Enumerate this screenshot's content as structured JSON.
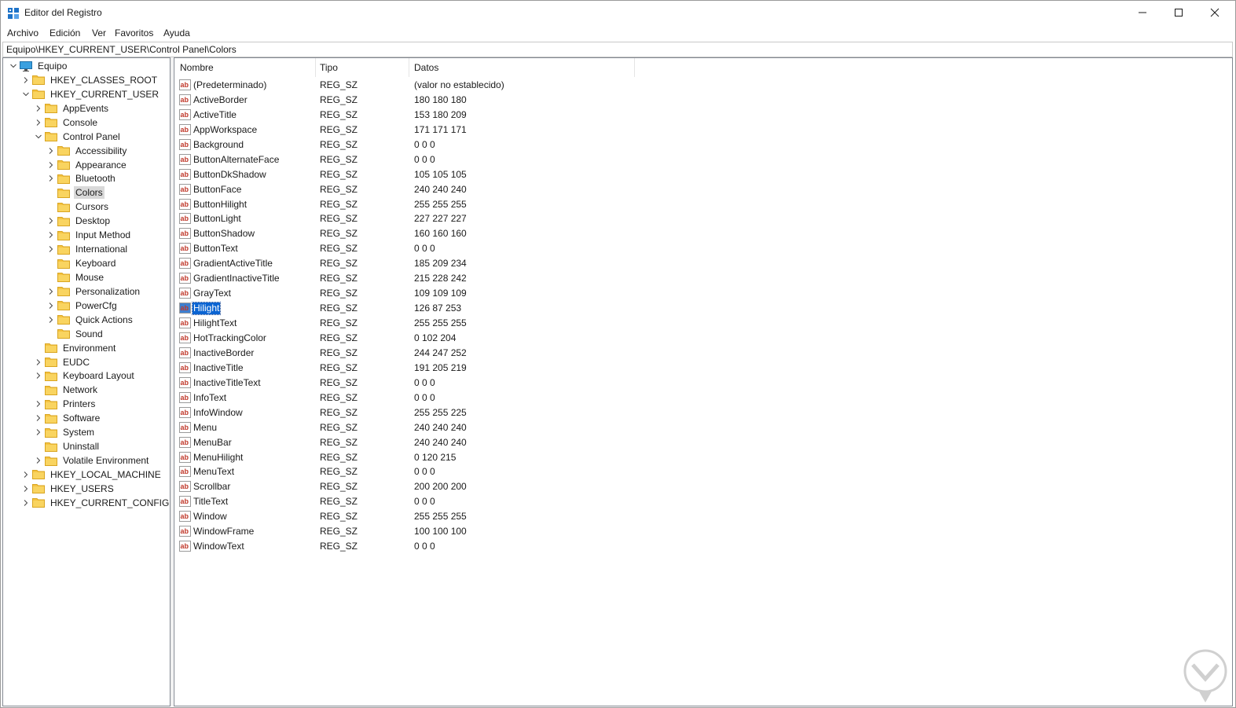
{
  "window": {
    "title": "Editor del Registro"
  },
  "menu": [
    "Archivo",
    "Edición",
    "Ver",
    "Favoritos",
    "Ayuda"
  ],
  "address": "Equipo\\HKEY_CURRENT_USER\\Control Panel\\Colors",
  "tree": [
    {
      "label": "Equipo",
      "level": 0,
      "expander": "expanded",
      "icon": "computer-icon"
    },
    {
      "label": "HKEY_CLASSES_ROOT",
      "level": 1,
      "expander": "collapsed"
    },
    {
      "label": "HKEY_CURRENT_USER",
      "level": 1,
      "expander": "expanded"
    },
    {
      "label": "AppEvents",
      "level": 2,
      "expander": "collapsed"
    },
    {
      "label": "Console",
      "level": 2,
      "expander": "collapsed"
    },
    {
      "label": "Control Panel",
      "level": 2,
      "expander": "expanded"
    },
    {
      "label": "Accessibility",
      "level": 3,
      "expander": "collapsed"
    },
    {
      "label": "Appearance",
      "level": 3,
      "expander": "collapsed"
    },
    {
      "label": "Bluetooth",
      "level": 3,
      "expander": "collapsed"
    },
    {
      "label": "Colors",
      "level": 3,
      "expander": "none",
      "selected": true
    },
    {
      "label": "Cursors",
      "level": 3,
      "expander": "none"
    },
    {
      "label": "Desktop",
      "level": 3,
      "expander": "collapsed"
    },
    {
      "label": "Input Method",
      "level": 3,
      "expander": "collapsed"
    },
    {
      "label": "International",
      "level": 3,
      "expander": "collapsed"
    },
    {
      "label": "Keyboard",
      "level": 3,
      "expander": "none"
    },
    {
      "label": "Mouse",
      "level": 3,
      "expander": "none"
    },
    {
      "label": "Personalization",
      "level": 3,
      "expander": "collapsed"
    },
    {
      "label": "PowerCfg",
      "level": 3,
      "expander": "collapsed"
    },
    {
      "label": "Quick Actions",
      "level": 3,
      "expander": "collapsed"
    },
    {
      "label": "Sound",
      "level": 3,
      "expander": "none"
    },
    {
      "label": "Environment",
      "level": 2,
      "expander": "none"
    },
    {
      "label": "EUDC",
      "level": 2,
      "expander": "collapsed"
    },
    {
      "label": "Keyboard Layout",
      "level": 2,
      "expander": "collapsed"
    },
    {
      "label": "Network",
      "level": 2,
      "expander": "none"
    },
    {
      "label": "Printers",
      "level": 2,
      "expander": "collapsed"
    },
    {
      "label": "Software",
      "level": 2,
      "expander": "collapsed"
    },
    {
      "label": "System",
      "level": 2,
      "expander": "collapsed"
    },
    {
      "label": "Uninstall",
      "level": 2,
      "expander": "none"
    },
    {
      "label": "Volatile Environment",
      "level": 2,
      "expander": "collapsed"
    },
    {
      "label": "HKEY_LOCAL_MACHINE",
      "level": 1,
      "expander": "collapsed"
    },
    {
      "label": "HKEY_USERS",
      "level": 1,
      "expander": "collapsed"
    },
    {
      "label": "HKEY_CURRENT_CONFIG",
      "level": 1,
      "expander": "collapsed"
    }
  ],
  "columns": {
    "name": "Nombre",
    "type": "Tipo",
    "data": "Datos"
  },
  "values": [
    {
      "name": "(Predeterminado)",
      "type": "REG_SZ",
      "data": "(valor no establecido)"
    },
    {
      "name": "ActiveBorder",
      "type": "REG_SZ",
      "data": "180 180 180"
    },
    {
      "name": "ActiveTitle",
      "type": "REG_SZ",
      "data": "153 180 209"
    },
    {
      "name": "AppWorkspace",
      "type": "REG_SZ",
      "data": "171 171 171"
    },
    {
      "name": "Background",
      "type": "REG_SZ",
      "data": "0 0 0"
    },
    {
      "name": "ButtonAlternateFace",
      "type": "REG_SZ",
      "data": "0 0 0"
    },
    {
      "name": "ButtonDkShadow",
      "type": "REG_SZ",
      "data": "105 105 105"
    },
    {
      "name": "ButtonFace",
      "type": "REG_SZ",
      "data": "240 240 240"
    },
    {
      "name": "ButtonHilight",
      "type": "REG_SZ",
      "data": "255 255 255"
    },
    {
      "name": "ButtonLight",
      "type": "REG_SZ",
      "data": "227 227 227"
    },
    {
      "name": "ButtonShadow",
      "type": "REG_SZ",
      "data": "160 160 160"
    },
    {
      "name": "ButtonText",
      "type": "REG_SZ",
      "data": "0 0 0"
    },
    {
      "name": "GradientActiveTitle",
      "type": "REG_SZ",
      "data": "185 209 234"
    },
    {
      "name": "GradientInactiveTitle",
      "type": "REG_SZ",
      "data": "215 228 242"
    },
    {
      "name": "GrayText",
      "type": "REG_SZ",
      "data": "109 109 109"
    },
    {
      "name": "Hilight",
      "type": "REG_SZ",
      "data": "126 87 253",
      "selected": true
    },
    {
      "name": "HilightText",
      "type": "REG_SZ",
      "data": "255 255 255"
    },
    {
      "name": "HotTrackingColor",
      "type": "REG_SZ",
      "data": "0 102 204"
    },
    {
      "name": "InactiveBorder",
      "type": "REG_SZ",
      "data": "244 247 252"
    },
    {
      "name": "InactiveTitle",
      "type": "REG_SZ",
      "data": "191 205 219"
    },
    {
      "name": "InactiveTitleText",
      "type": "REG_SZ",
      "data": "0 0 0"
    },
    {
      "name": "InfoText",
      "type": "REG_SZ",
      "data": "0 0 0"
    },
    {
      "name": "InfoWindow",
      "type": "REG_SZ",
      "data": "255 255 225"
    },
    {
      "name": "Menu",
      "type": "REG_SZ",
      "data": "240 240 240"
    },
    {
      "name": "MenuBar",
      "type": "REG_SZ",
      "data": "240 240 240"
    },
    {
      "name": "MenuHilight",
      "type": "REG_SZ",
      "data": "0 120 215"
    },
    {
      "name": "MenuText",
      "type": "REG_SZ",
      "data": "0 0 0"
    },
    {
      "name": "Scrollbar",
      "type": "REG_SZ",
      "data": "200 200 200"
    },
    {
      "name": "TitleText",
      "type": "REG_SZ",
      "data": "0 0 0"
    },
    {
      "name": "Window",
      "type": "REG_SZ",
      "data": "255 255 255"
    },
    {
      "name": "WindowFrame",
      "type": "REG_SZ",
      "data": "100 100 100"
    },
    {
      "name": "WindowText",
      "type": "REG_SZ",
      "data": "0 0 0"
    }
  ],
  "colors": {
    "selection": "#0a64d2",
    "tree_selection": "#d9d9d9",
    "folder": "#f7c948",
    "icon_red": "#c0392b"
  },
  "icons": {
    "value": "string-value-icon",
    "folder": "folder-icon",
    "app": "regedit-icon",
    "watermark": "watermark-logo-icon"
  }
}
